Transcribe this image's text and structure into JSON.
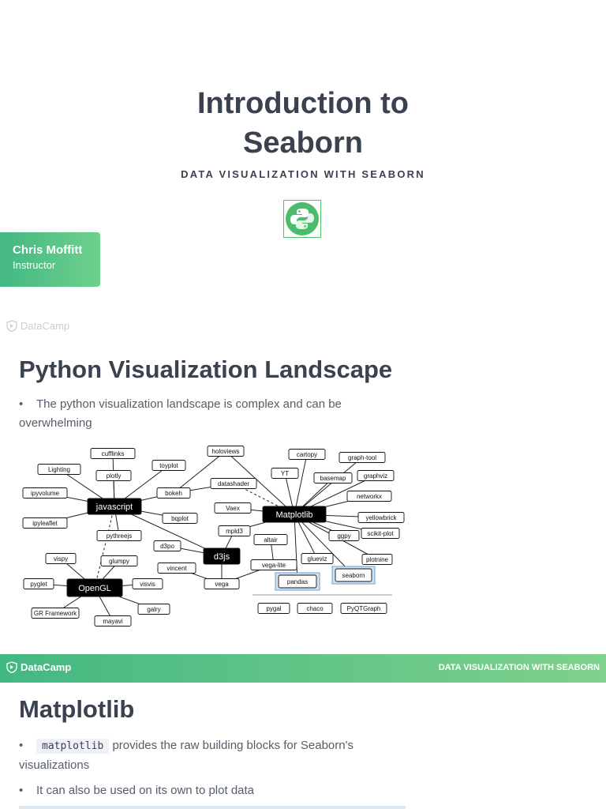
{
  "slide1": {
    "title_line1": "Introduction to",
    "title_line2": "Seaborn",
    "subtitle": "DATA VISUALIZATION WITH SEABORN",
    "instructor_name": "Chris Moffitt",
    "instructor_role": "Instructor",
    "brand": "DataCamp"
  },
  "slide2": {
    "title": "Python Visualization Landscape",
    "bullet1": "The python visualization landscape is complex and can be overwhelming",
    "diagram_nodes": {
      "cufflinks": "cufflinks",
      "toyplot": "toyplot",
      "lighting": "Lighting",
      "plotly": "plotly",
      "ipyvolume": "ipyvolume",
      "javascript": "javascript",
      "ipyleaflet": "ipyleaflet",
      "pythreejs": "pythreejs",
      "holoviews": "holoviews",
      "datashader": "datashader",
      "bokeh": "bokeh",
      "vaex": "Vaex",
      "bqplot": "bqplot",
      "cartopy": "cartopy",
      "yt": "YT",
      "basemap": "basemap",
      "graph_tool": "graph-tool",
      "graphviz": "graphviz",
      "networkx": "networkx",
      "matplotlib": "Matplotlib",
      "yellowbrick": "yellowbrick",
      "scikit_plot": "scikit-plot",
      "ggpy": "ggpy",
      "plotnine": "plotnine",
      "mpld3": "mpld3",
      "altair": "altair",
      "d3po": "d3po",
      "d3js": "d3js",
      "vincent": "vincent",
      "vega": "vega",
      "vega_lite": "vega-lite",
      "glueviz": "glueviz",
      "pandas": "pandas",
      "seaborn": "seaborn",
      "vispy": "vispy",
      "glumpy": "glumpy",
      "pyglet": "pyglet",
      "opengl": "OpenGL",
      "visvis": "visvis",
      "galry": "galry",
      "qt_framework": "GR Framework",
      "mayavi": "mayavi",
      "pygal": "pygal",
      "chaco": "chaco",
      "pyqtgraph": "PyQTGraph"
    }
  },
  "footer": {
    "brand": "DataCamp",
    "course": "DATA VISUALIZATION WITH SEABORN"
  },
  "slide3": {
    "title": "Matplotlib",
    "bullet1_code": "matplotlib",
    "bullet1_text": " provides the raw building blocks for Seaborn's visualizations",
    "bullet2": "It can also be used on its own to plot data"
  },
  "colors": {
    "text": "#3a4250",
    "accent_green": "#43b883",
    "highlight_box": "#cfe3f5"
  }
}
